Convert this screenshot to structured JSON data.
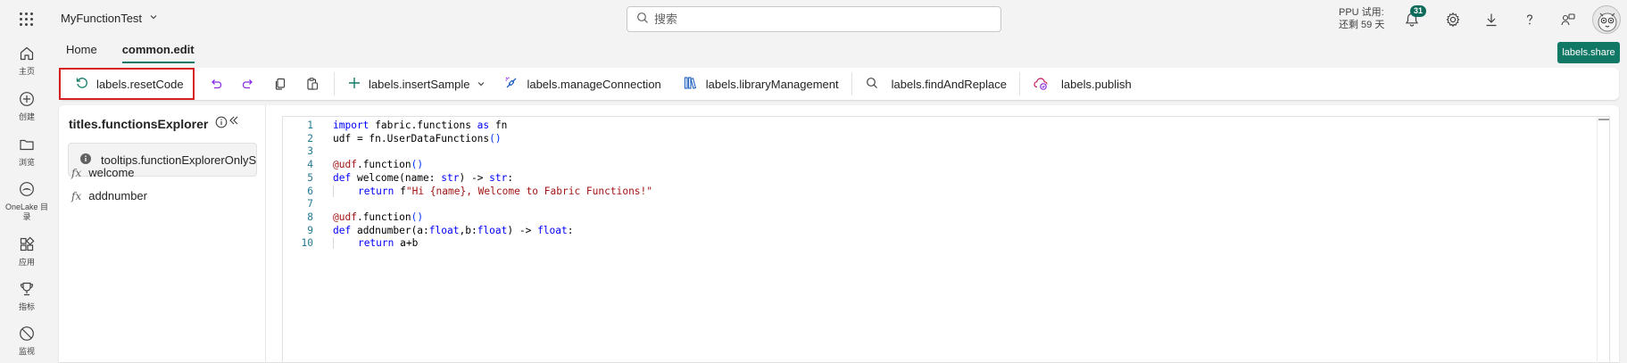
{
  "app": {
    "workspace_name": "MyFunctionTest",
    "search_placeholder": "搜索",
    "trial_line1": "PPU 试用:",
    "trial_line2": "还剩 59 天",
    "notifications_count": "31"
  },
  "leftnav": {
    "items": [
      {
        "label": "主页",
        "icon": "home-icon"
      },
      {
        "label": "创建",
        "icon": "create-icon"
      },
      {
        "label": "浏览",
        "icon": "browse-icon"
      },
      {
        "label": "OneLake 目录",
        "icon": "onelake-icon"
      },
      {
        "label": "应用",
        "icon": "apps-icon"
      },
      {
        "label": "指标",
        "icon": "metrics-icon"
      },
      {
        "label": "监视",
        "icon": "monitor-icon"
      }
    ]
  },
  "tabs": {
    "home": "Home",
    "edit": "common.edit"
  },
  "share_label": "labels.share",
  "toolbar": {
    "reset_code": "labels.resetCode",
    "insert_sample": "labels.insertSample",
    "manage_connection": "labels.manageConnection",
    "library_management": "labels.libraryManagement",
    "find_and_replace": "labels.findAndReplace",
    "publish": "labels.publish"
  },
  "explorer": {
    "title": "titles.functionsExplorer",
    "tooltip": "tooltips.functionExplorerOnlyShow",
    "functions": [
      "welcome",
      "addnumber"
    ]
  },
  "editor": {
    "line_numbers": [
      "1",
      "2",
      "3",
      "4",
      "5",
      "6",
      "7",
      "8",
      "9",
      "10"
    ]
  },
  "colors": {
    "accent": "#117865",
    "badge": "#0f6b5a",
    "highlight_border": "#d42020"
  }
}
